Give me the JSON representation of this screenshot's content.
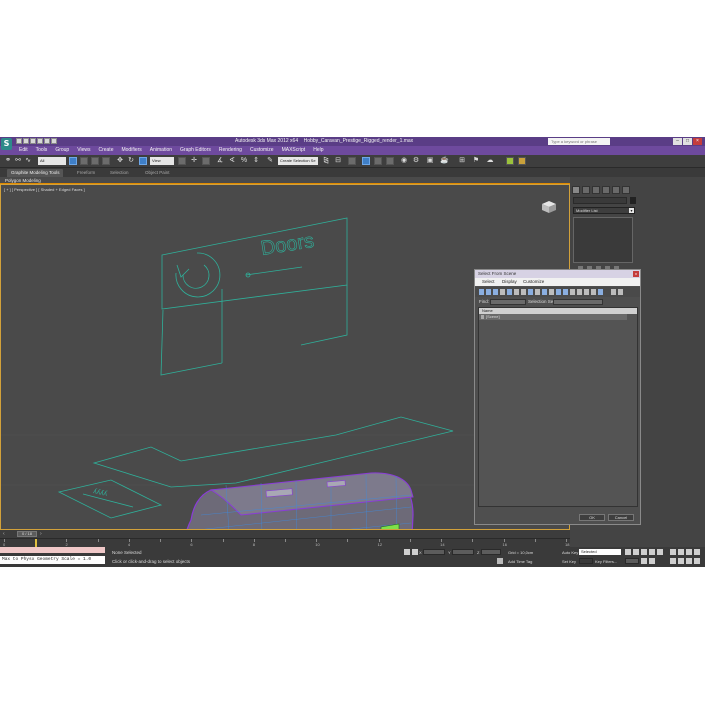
{
  "app": {
    "logo": "S",
    "title": "Autodesk 3ds Max 2012 x64",
    "filename": "Hobby_Caravan_Prestige_Rigged_render_1.max",
    "search_placeholder": "Type a keyword or phrase"
  },
  "menu": [
    "Edit",
    "Tools",
    "Group",
    "Views",
    "Create",
    "Modifiers",
    "Animation",
    "Graph Editors",
    "Rendering",
    "Customize",
    "MAXScript",
    "Help"
  ],
  "toolbar": {
    "filter_value": "All",
    "view_value": "View",
    "selection_set_value": "Create Selection Se"
  },
  "ribbon": {
    "tabs": [
      "Graphite Modeling Tools",
      "Freeform",
      "Selection",
      "Object Paint"
    ],
    "active_tab": 0,
    "subpanel": "Polygon Modeling"
  },
  "viewport": {
    "label": "[ + ] [ Perspective ] [ Shaded + Edged Faces ]",
    "sign_text": "Doors"
  },
  "command_panel": {
    "modifier_list": "Modifier List"
  },
  "dialog": {
    "title": "Select From Scene",
    "close": "x",
    "menu": [
      "Select",
      "Display",
      "Customize"
    ],
    "find_label": "Find:",
    "selection_set_label": "Selection Set:",
    "column_header": "Name",
    "rows": [
      "[Scene]"
    ],
    "ok": "OK",
    "cancel": "Cancel"
  },
  "timeline": {
    "frame": "0 / 18",
    "ticks": [
      "0",
      "1",
      "2",
      "3",
      "4",
      "5",
      "6",
      "7",
      "8",
      "9",
      "10",
      "11",
      "12",
      "13",
      "14",
      "15",
      "16",
      "17",
      "18"
    ]
  },
  "status": {
    "maxscript_line": "Max to Physx Geometry Scale = 1.0",
    "selection": "None Selected",
    "prompt": "Click or click-and-drag to select objects",
    "x": "X",
    "y": "Y",
    "z": "Z",
    "grid": "Grid = 10,0cm",
    "add_time_tag": "Add Time Tag",
    "auto_key": "Auto Key",
    "auto_key_value": "Selected",
    "set_key": "Set Key",
    "key_filters": "Key Filters..."
  }
}
